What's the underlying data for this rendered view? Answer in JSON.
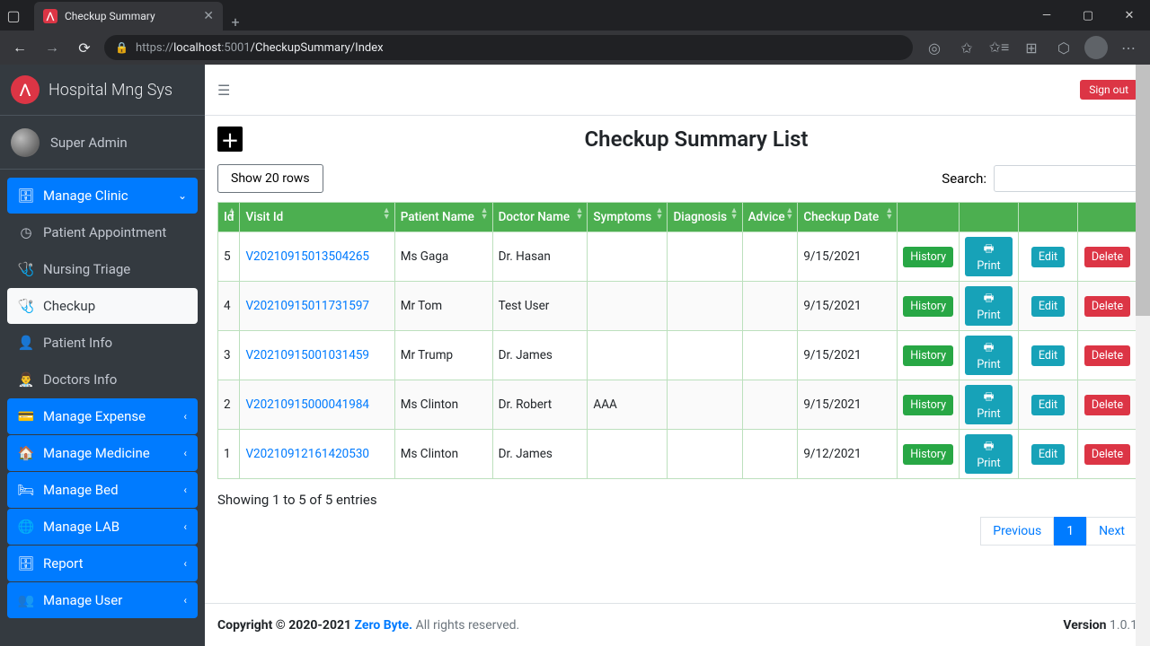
{
  "browser": {
    "tab_title": "Checkup Summary",
    "url_prefix": "https://",
    "url_host": "localhost",
    "url_port": ":5001",
    "url_path": "/CheckupSummary/Index"
  },
  "sidebar": {
    "brand": "Hospital Mng Sys",
    "user": "Super Admin",
    "items": [
      {
        "label": "Manage Clinic",
        "icon": "🗄",
        "style": "blue",
        "chev": "⌄"
      },
      {
        "label": "Patient Appointment",
        "icon": "◷",
        "style": ""
      },
      {
        "label": "Nursing Triage",
        "icon": "🩺",
        "style": ""
      },
      {
        "label": "Checkup",
        "icon": "🩺",
        "style": "active"
      },
      {
        "label": "Patient Info",
        "icon": "👤",
        "style": ""
      },
      {
        "label": "Doctors Info",
        "icon": "👨‍⚕️",
        "style": ""
      },
      {
        "label": "Manage Expense",
        "icon": "💳",
        "style": "blue",
        "chev": "‹"
      },
      {
        "label": "Manage Medicine",
        "icon": "🏠",
        "style": "blue",
        "chev": "‹"
      },
      {
        "label": "Manage Bed",
        "icon": "🛏",
        "style": "blue",
        "chev": "‹"
      },
      {
        "label": "Manage LAB",
        "icon": "🌐",
        "style": "blue",
        "chev": "‹"
      },
      {
        "label": "Report",
        "icon": "🗄",
        "style": "blue",
        "chev": "‹"
      },
      {
        "label": "Manage User",
        "icon": "👥",
        "style": "blue",
        "chev": "‹"
      }
    ]
  },
  "header": {
    "signout": "Sign out"
  },
  "page": {
    "title": "Checkup Summary List",
    "show_rows": "Show 20 rows",
    "search_label": "Search:",
    "search_value": ""
  },
  "table": {
    "columns": [
      "Id",
      "Visit Id",
      "Patient Name",
      "Doctor Name",
      "Symptoms",
      "Diagnosis",
      "Advice",
      "Checkup Date",
      "",
      "",
      "",
      ""
    ],
    "rows": [
      {
        "id": "5",
        "visit": "V20210915013504265",
        "patient": "Ms Gaga",
        "doctor": "Dr. Hasan",
        "symptoms": "",
        "diagnosis": "",
        "advice": "",
        "date": "9/15/2021"
      },
      {
        "id": "4",
        "visit": "V20210915011731597",
        "patient": "Mr Tom",
        "doctor": "Test User",
        "symptoms": "",
        "diagnosis": "",
        "advice": "",
        "date": "9/15/2021"
      },
      {
        "id": "3",
        "visit": "V20210915001031459",
        "patient": "Mr Trump",
        "doctor": "Dr. James",
        "symptoms": "",
        "diagnosis": "",
        "advice": "",
        "date": "9/15/2021"
      },
      {
        "id": "2",
        "visit": "V20210915000041984",
        "patient": "Ms Clinton",
        "doctor": "Dr. Robert",
        "symptoms": "AAA",
        "diagnosis": "",
        "advice": "",
        "date": "9/15/2021"
      },
      {
        "id": "1",
        "visit": "V20210912161420530",
        "patient": "Ms Clinton",
        "doctor": "Dr. James",
        "symptoms": "",
        "diagnosis": "",
        "advice": "",
        "date": "9/12/2021"
      }
    ],
    "actions": {
      "history": "History",
      "print": "Print",
      "edit": "Edit",
      "delete": "Delete"
    }
  },
  "entries_info": "Showing 1 to 5 of 5 entries",
  "pagination": {
    "prev": "Previous",
    "page": "1",
    "next": "Next"
  },
  "footer": {
    "copyright_prefix": "Copyright © 2020-2021 ",
    "company": "Zero Byte.",
    "copyright_suffix": " All rights reserved.",
    "version_label": "Version",
    "version": " 1.0.1"
  }
}
